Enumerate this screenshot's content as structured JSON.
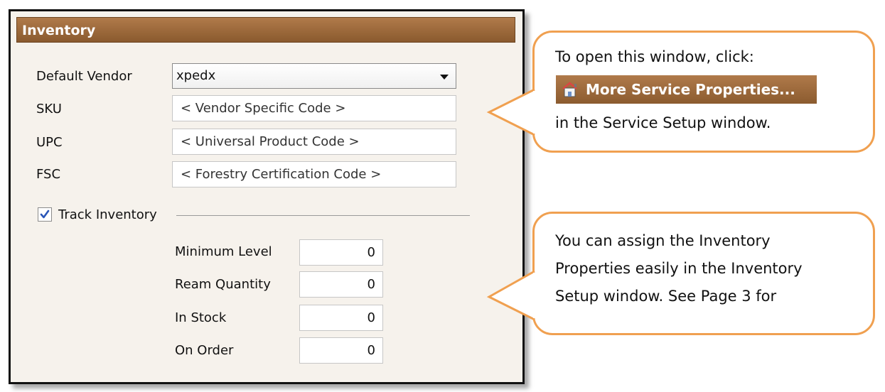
{
  "panel": {
    "title": "Inventory",
    "fields": {
      "default_vendor_label": "Default Vendor",
      "default_vendor_value": "xpedx",
      "sku_label": "SKU",
      "sku_placeholder": "< Vendor Specific Code >",
      "upc_label": "UPC",
      "upc_placeholder": "< Universal Product Code >",
      "fsc_label": "FSC",
      "fsc_placeholder": "< Forestry Certification Code >"
    },
    "track_inventory": {
      "label": "Track Inventory",
      "checked": true
    },
    "levels": {
      "minimum_level_label": "Minimum Level",
      "minimum_level_value": "0",
      "ream_quantity_label": "Ream Quantity",
      "ream_quantity_value": "0",
      "in_stock_label": "In Stock",
      "in_stock_value": "0",
      "on_order_label": "On Order",
      "on_order_value": "0"
    }
  },
  "callouts": {
    "top": {
      "line1": "To open this window, click:",
      "button_label": "More Service Properties...",
      "line3": "in the Service Setup window."
    },
    "bottom": {
      "line1": "You can assign the Inventory",
      "line2": "Properties easily in the Inventory",
      "line3": "Setup window. See Page 3 for"
    }
  },
  "colors": {
    "header_brown": "#9a6a3c",
    "callout_border": "#f0a050",
    "panel_bg": "#f6f2ec"
  },
  "icons": [
    "dropdown-arrow-icon",
    "checkmark-icon",
    "house-icon"
  ]
}
